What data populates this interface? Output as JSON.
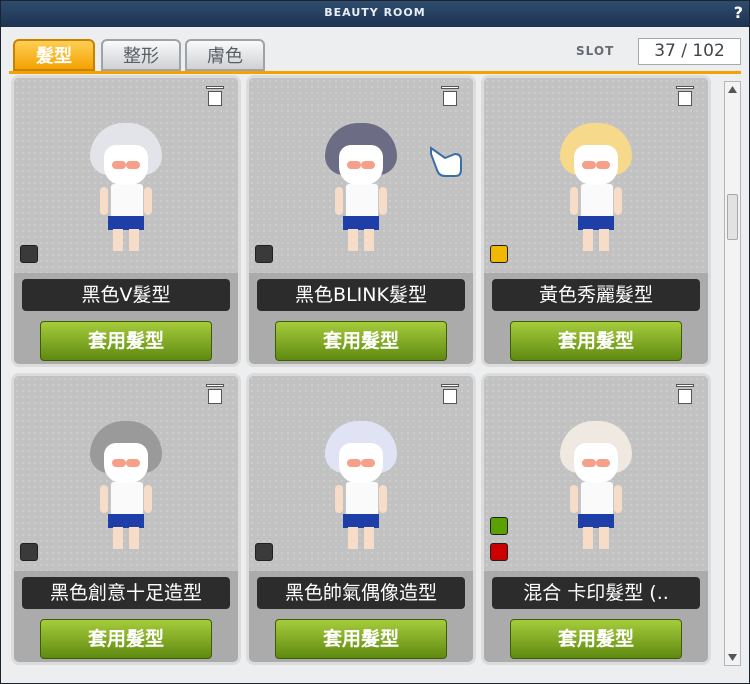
{
  "window": {
    "title": "BEAUTY ROOM",
    "help_label": "?"
  },
  "tabs": [
    {
      "label": "髮型",
      "active": true
    },
    {
      "label": "整形",
      "active": false
    },
    {
      "label": "膚色",
      "active": false
    }
  ],
  "slot": {
    "label": "SLOT",
    "value": "37 / 102"
  },
  "cards": [
    {
      "name": "黑色V髮型",
      "button": "套用髮型",
      "hair_color": "#e3e3ea",
      "swatches": [
        "#3a3a3a"
      ],
      "pointer": false
    },
    {
      "name": "黑色BLINK髮型",
      "button": "套用髮型",
      "hair_color": "#6c6c84",
      "swatches": [
        "#3a3a3a"
      ],
      "pointer": true
    },
    {
      "name": "黃色秀麗髮型",
      "button": "套用髮型",
      "hair_color": "#f6d98a",
      "swatches": [
        "#f0b800"
      ],
      "pointer": false
    },
    {
      "name": "黑色創意十足造型",
      "button": "套用髮型",
      "hair_color": "#9a9a9a",
      "swatches": [
        "#3a3a3a"
      ],
      "pointer": false
    },
    {
      "name": "黑色帥氣偶像造型",
      "button": "套用髮型",
      "hair_color": "#dfe3f4",
      "swatches": [
        "#3a3a3a"
      ],
      "pointer": false
    },
    {
      "name": "混合 卡印髮型 (..",
      "button": "套用髮型",
      "hair_color": "#efe9e2",
      "swatches": [
        "#5aa000",
        "#cc0000"
      ],
      "pointer": false
    }
  ],
  "icons": {
    "delete": "trash-icon",
    "pointer": "pointing-hand-icon",
    "help": "question-icon"
  },
  "colors": {
    "accent": "#f3a200",
    "apply_button": "#7fa91f",
    "title_bar": "#24405f"
  }
}
